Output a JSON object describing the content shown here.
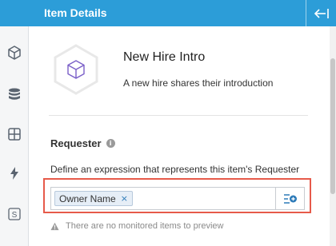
{
  "header": {
    "title": "Item Details"
  },
  "item": {
    "name": "New Hire Intro",
    "description": "A new hire shares their introduction"
  },
  "requester": {
    "label": "Requester",
    "description": "Define an expression that represents this item's Requester",
    "chip_label": "Owner Name",
    "chip_remove": "×"
  },
  "warning": {
    "text": "There are no monitored items to preview"
  },
  "rail": {
    "items": [
      "cube-icon",
      "database-icon",
      "grid-icon",
      "lightning-icon",
      "script-icon"
    ],
    "script_letter": "S"
  },
  "colors": {
    "header": "#2c9dd8",
    "highlight": "#e65a4a",
    "chip_bg": "#e6eef7"
  }
}
